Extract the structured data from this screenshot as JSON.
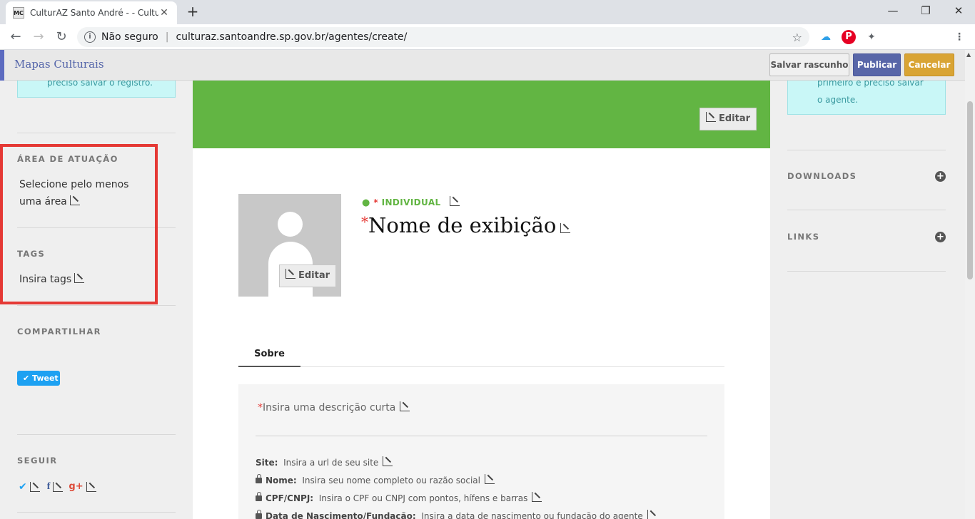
{
  "browser": {
    "tab_title": "CulturAZ Santo André - - CulturAZ",
    "favicon_text": "MC",
    "security_label": "Não seguro",
    "url": "culturaz.santoandre.sp.gov.br/agentes/create/"
  },
  "header": {
    "logo": "Mapas Culturais",
    "save_draft": "Salvar rascunho",
    "publish": "Publicar",
    "cancel": "Cancelar"
  },
  "left": {
    "alert_text": "preciso salvar o registro.",
    "area_title": "ÁREA DE ATUAÇÃO",
    "area_text": "Selecione pelo menos uma área",
    "tags_title": "TAGS",
    "tags_text": "Insira tags",
    "share_title": "COMPARTILHAR",
    "tweet_label": "Tweet",
    "follow_title": "SEGUIR"
  },
  "right": {
    "alert_line1": "primeiro é preciso salvar",
    "alert_line2": "o agente.",
    "downloads_title": "DOWNLOADS",
    "links_title": "LINKS"
  },
  "main": {
    "cover_edit": "Editar",
    "avatar_edit": "Editar",
    "type_required": "*",
    "type_label": "INDIVIDUAL",
    "name_required": "*",
    "name_placeholder": "Nome de exibição",
    "tab_about": "Sobre",
    "short_desc_required": "*",
    "short_desc": "Insira uma descrição curta",
    "fields": [
      {
        "label": "Site:",
        "value": "Insira a url de seu site"
      },
      {
        "label": "Nome:",
        "value": "Insira seu nome completo ou razão social"
      },
      {
        "label": "CPF/CNPJ:",
        "value": "Insira o CPF ou CNPJ com pontos, hífens e barras"
      },
      {
        "label": "Data de Nascimento/Fundação:",
        "value": "Insira a data de nascimento ou fundação do agente"
      }
    ]
  },
  "colors": {
    "cover_green": "#62b543",
    "publish_blue": "#5866a8",
    "cancel_gold": "#d9a434",
    "highlight_red": "#e53935"
  }
}
